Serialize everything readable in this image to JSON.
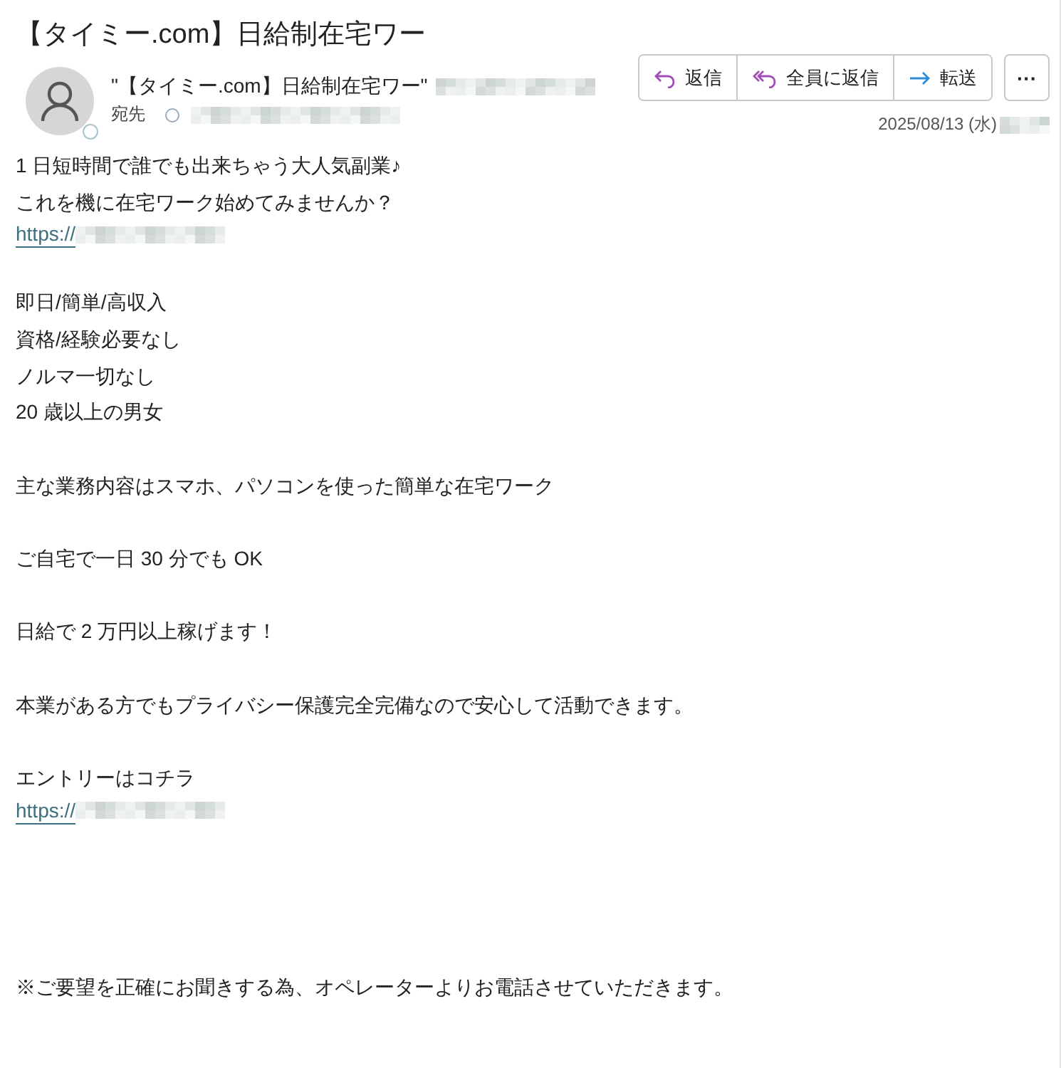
{
  "subject": "【タイミー.com】日給制在宅ワー",
  "sender": {
    "name": "\"【タイミー.com】日給制在宅ワー\"",
    "to_label": "宛先",
    "date": "2025/08/13 (水)"
  },
  "actions": [
    {
      "kind": "reply",
      "label": "返信"
    },
    {
      "kind": "reply_all",
      "label": "全員に返信"
    },
    {
      "kind": "forward",
      "label": "転送"
    },
    {
      "kind": "more",
      "label": "···"
    }
  ],
  "body": [
    {
      "kind": "paragraph",
      "lines": [
        {
          "kind": "text",
          "text": "1 日短時間で誰でも出来ちゃう大人気副業♪"
        },
        {
          "kind": "text",
          "text": "これを機に在宅ワーク始めてみませんか？"
        },
        {
          "kind": "link",
          "text": "https://"
        }
      ]
    },
    {
      "kind": "paragraph",
      "lines": [
        {
          "kind": "text",
          "text": "即日/簡単/高収入"
        },
        {
          "kind": "text",
          "text": "資格/経験必要なし"
        },
        {
          "kind": "text",
          "text": "ノルマ一切なし"
        },
        {
          "kind": "text",
          "text": "20 歳以上の男女"
        }
      ]
    },
    {
      "kind": "paragraph",
      "lines": [
        {
          "kind": "text",
          "text": "主な業務内容はスマホ、パソコンを使った簡単な在宅ワーク"
        }
      ]
    },
    {
      "kind": "paragraph",
      "lines": [
        {
          "kind": "text",
          "text": "ご自宅で一日 30 分でも OK"
        }
      ]
    },
    {
      "kind": "paragraph",
      "lines": [
        {
          "kind": "text",
          "text": "日給で 2 万円以上稼げます！"
        }
      ]
    },
    {
      "kind": "paragraph",
      "lines": [
        {
          "kind": "text",
          "text": "本業がある方でもプライバシー保護完全完備なので安心して活動できます。"
        }
      ]
    },
    {
      "kind": "paragraph",
      "lines": [
        {
          "kind": "text",
          "text": "エントリーはコチラ"
        },
        {
          "kind": "link",
          "text": "https://"
        }
      ]
    },
    {
      "kind": "footnote",
      "lines": [
        {
          "kind": "text",
          "text": "※ご要望を正確にお聞きする為、オペレーターよりお電話させていただきます。"
        }
      ]
    }
  ]
}
